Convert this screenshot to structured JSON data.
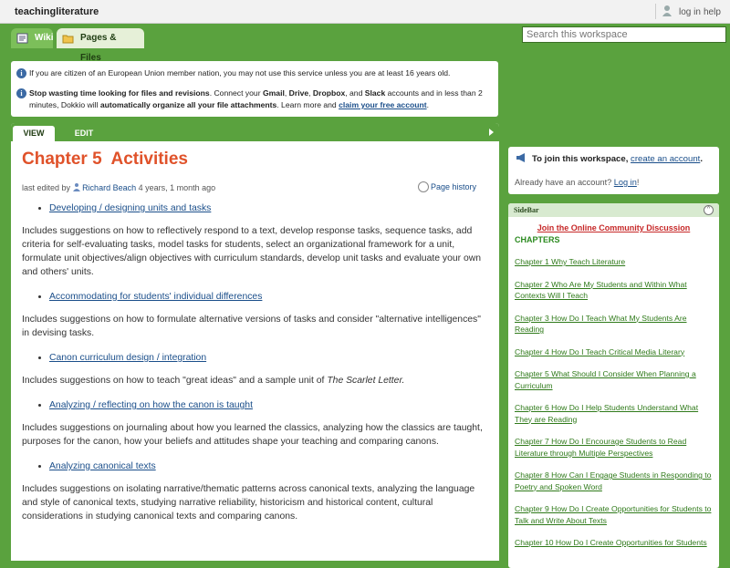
{
  "top": {
    "site_name": "teachingliterature",
    "login": "log in",
    "help": "help"
  },
  "tabs": {
    "wiki": "Wiki",
    "pages_files": "Pages & Files"
  },
  "search": {
    "placeholder": "Search this workspace"
  },
  "notice": {
    "eu": "If you are citizen of an European Union member nation, you may not use this service unless you are at least 16 years old.",
    "dokkio_bold": "Stop wasting time looking for files and revisions",
    "dokkio_a": ". Connect your ",
    "gmail": "Gmail",
    "drive": "Drive",
    "dropbox": "Dropbox",
    "slack": "Slack",
    "dokkio_b": " accounts and in less than 2 minutes, Dokkio will ",
    "dokkio_bold2": "automatically organize all your file attachments",
    "dokkio_c": ". Learn more and ",
    "claim": "claim your free account"
  },
  "view_tabs": {
    "view": "VIEW",
    "edit": "EDIT"
  },
  "page": {
    "title": "Chapter 5  Activities",
    "edited_prefix": "last edited by ",
    "editor": "Richard Beach",
    "edited_suffix": " 4 years, 1 month ago",
    "history": "Page history"
  },
  "content": {
    "link1": "Developing / designing units and tasks",
    "p1": "Includes suggestions on how to reflectively respond to a text, develop response tasks, sequence tasks, add criteria for self-evaluating tasks, model tasks for students, select an organizational framework for a unit, formulate unit objectives/align objectives with curriculum standards, develop unit tasks and evaluate your own and others' units.",
    "link2": "Accommodating for students' individual differences",
    "p2": "Includes suggestions on how to formulate alternative versions of tasks and consider \"alternative intelligences\" in devising tasks.",
    "link3": "Canon curriculum design / integration",
    "p3a": "Includes suggestions on how to teach \"great ideas\" and a sample unit of ",
    "p3b": "The Scarlet Letter.",
    "link4": "Analyzing / reflecting on how the canon is taught",
    "p4": "Includes suggestions on journaling about how you learned the classics, analyzing how the classics are taught, purposes for the canon, how your beliefs and attitudes shape your teaching and comparing canons.",
    "link5": "Analyzing canonical texts",
    "p5": "Includes suggestions on isolating narrative/thematic patterns across canonical texts, analyzing the language and style of canonical texts, studying narrative reliability, historicism and historical content, cultural considerations in studying canonical texts and comparing canons."
  },
  "join": {
    "prefix": "To join this workspace, ",
    "link": "create an account",
    "suffix": ".",
    "already": "Already have an account? ",
    "login": "Log in",
    "excl": "!"
  },
  "sidebar": {
    "label": "SideBar",
    "collapse": "^",
    "join_link": "Join the Online Community Discussion",
    "chapters": "CHAPTERS",
    "items": [
      "Chapter 1 Why Teach Literature",
      "Chapter 2 Who Are My Students and Within What Contexts Will I Teach",
      "Chapter 3 How Do I Teach What My Students Are Reading",
      "Chapter 4 How Do I Teach Critical Media Literary",
      "Chapter 5 What Should I Consider When Planning a Curriculum",
      "Chapter 6 How Do I Help Students Understand What They are Reading",
      "Chapter 7 How Do I Encourage Students to Read Literature through Multiple Perspectives",
      "Chapter 8 How Can I Engage Students in Responding to Poetry and Spoken Word",
      "Chapter 9 How Do I Create Opportunities for Students to Talk and Write About Texts",
      "Chapter 10 How Do I Create Opportunities for Students"
    ]
  }
}
